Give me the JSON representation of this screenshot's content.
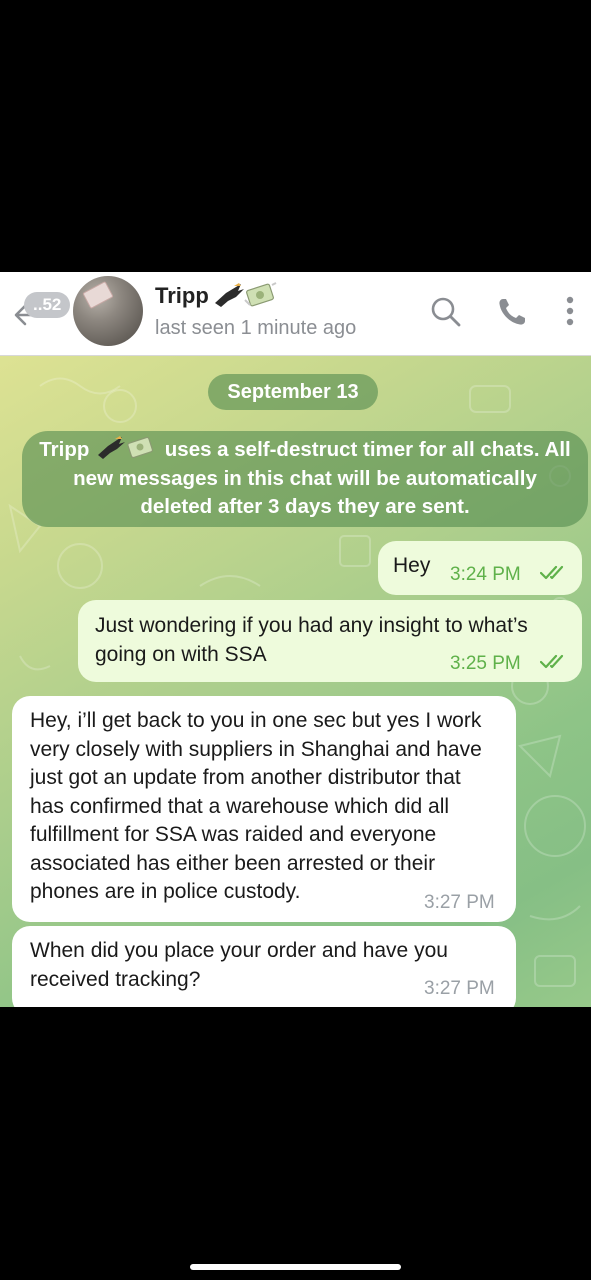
{
  "header": {
    "unread_count": "..52",
    "contact_name": "Tripp",
    "name_emoji": [
      "eagle-emoji",
      "money-with-wings-emoji"
    ],
    "status": "last seen 1 minute ago",
    "icons": [
      "back-arrow-icon",
      "search-icon",
      "phone-icon",
      "more-vertical-icon"
    ]
  },
  "chat": {
    "date_label": "September 13",
    "service_message": {
      "name": "Tripp",
      "text_line1": "uses a self-destruct timer for all chats. All",
      "text_line2": "new messages in this chat will be automatically",
      "text_line3": "deleted after 3 days they are sent."
    },
    "messages": [
      {
        "direction": "out",
        "lines": [
          "Hey"
        ],
        "time": "3:24 PM",
        "status": "read"
      },
      {
        "direction": "out",
        "lines": [
          "Just wondering if you had any insight to what’s",
          "going on with SSA"
        ],
        "time": "3:25 PM",
        "status": "read"
      },
      {
        "direction": "in",
        "lines": [
          "Hey, i’ll get back to you in one sec but yes I work",
          "very closely with suppliers in Shanghai and have",
          "just got an update from another distributor that",
          "has confirmed that a warehouse which did all",
          "fulfillment for SSA was raided and everyone",
          "associated has either been arrested or their",
          "phones are in police custody."
        ],
        "time": "3:27 PM"
      },
      {
        "direction": "in",
        "lines": [
          "When did you place your order and have you",
          "received tracking?"
        ],
        "time": "3:27 PM"
      }
    ]
  },
  "colors": {
    "outgoing_bubble": "#eefbdc",
    "incoming_bubble": "#ffffff",
    "outgoing_time": "#5fb14a",
    "incoming_time": "#9aa0a6",
    "service_pill": "#568c50",
    "header_background": "#ffffff"
  }
}
